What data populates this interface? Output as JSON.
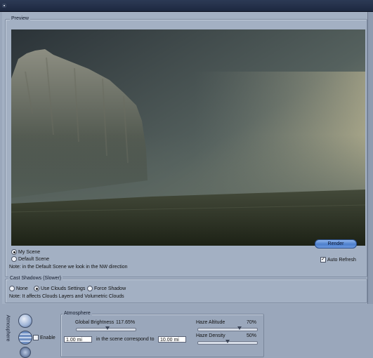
{
  "preview": {
    "title": "Preview",
    "scene_options": [
      "My Scene",
      "Default Scene"
    ],
    "selected_scene": "My Scene",
    "note": "Note: in the Default Scene we look in the NW direction",
    "render_label": "Render",
    "auto_refresh_label": "Auto Refresh",
    "auto_refresh_checked": true
  },
  "cast_shadows": {
    "title": "Cast Shadows (Slower)",
    "options": [
      "None",
      "Use Clouds Settings",
      "Force Shadow"
    ],
    "selected": "Use Clouds Settings",
    "note": "Note: It affects Clouds Layers and Volumetric Clouds"
  },
  "side_tab": {
    "label": "Atmosphere"
  },
  "atmosphere": {
    "title": "Atmosphere",
    "enable_label": "Enable",
    "global_brightness_label": "Global Brightness",
    "global_brightness_value": "117.65%",
    "haze_altitude_label": "Haze Altitude",
    "haze_altitude_value": "70%",
    "haze_density_label": "Haze Density",
    "haze_density_value": "50%",
    "distance_input": "1.00 mi",
    "scene_text": "in the scene correspond to",
    "scene_distance_input": "10.00 mi"
  }
}
